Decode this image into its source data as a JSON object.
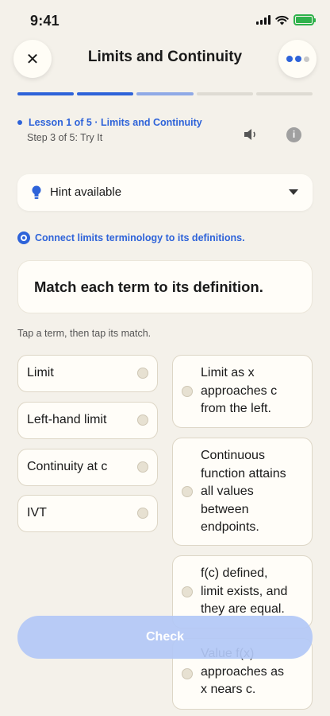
{
  "status_bar": {
    "time": "9:41"
  },
  "header": {
    "title": "Limits and Continuity"
  },
  "progress": {
    "segments": [
      "done",
      "done",
      "current",
      "pending",
      "pending"
    ]
  },
  "lesson": {
    "label": "Lesson 1 of 5 · Limits and Continuity",
    "step": "Step 3 of 5: Try It",
    "info_glyph": "i"
  },
  "hint": {
    "label": "Hint available"
  },
  "goal": {
    "text": "Connect limits terminology to its definitions."
  },
  "question": {
    "text": "Match each term to its definition."
  },
  "instruction": "Tap a term, then tap its match.",
  "terms": [
    "Limit",
    "Left-hand limit",
    "Continuity at c",
    "IVT"
  ],
  "definitions": [
    [
      "Limit as x",
      "approaches c",
      "from the left."
    ],
    [
      "Continuous",
      "function attains",
      "all values",
      "between",
      "endpoints."
    ],
    [
      "f(c) defined,",
      "limit exists, and",
      "they are equal."
    ],
    [
      "Value f(x)",
      "approaches as",
      "x nears c."
    ]
  ],
  "check_button": {
    "label": "Check"
  },
  "colors": {
    "accent": "#2e63d9",
    "background": "#f4f1ea",
    "battery": "#2fb24c"
  },
  "icons": [
    "close-icon",
    "more-icon",
    "speaker-icon",
    "info-icon",
    "lightbulb-icon",
    "chevron-down-icon",
    "target-icon"
  ]
}
